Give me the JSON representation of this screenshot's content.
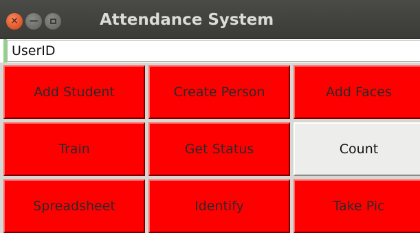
{
  "window": {
    "title": "Attendance System",
    "controls": {
      "close_icon": "close-icon",
      "minimize_icon": "minimize-icon",
      "maximize_icon": "maximize-icon"
    }
  },
  "entry": {
    "value": "UserID"
  },
  "buttons": {
    "add_student": "Add Student",
    "create_person": "Create Person",
    "add_faces": "Add Faces",
    "train": "Train",
    "get_status": "Get Status",
    "count": "Count",
    "spreadsheet": "Spreadsheet",
    "identify": "Identify",
    "take_pic": "Take Pic"
  },
  "colors": {
    "button_red": "#ff0000",
    "button_default": "#ededeb",
    "titlebar": "#3c3b37",
    "close_button": "#e95420"
  }
}
